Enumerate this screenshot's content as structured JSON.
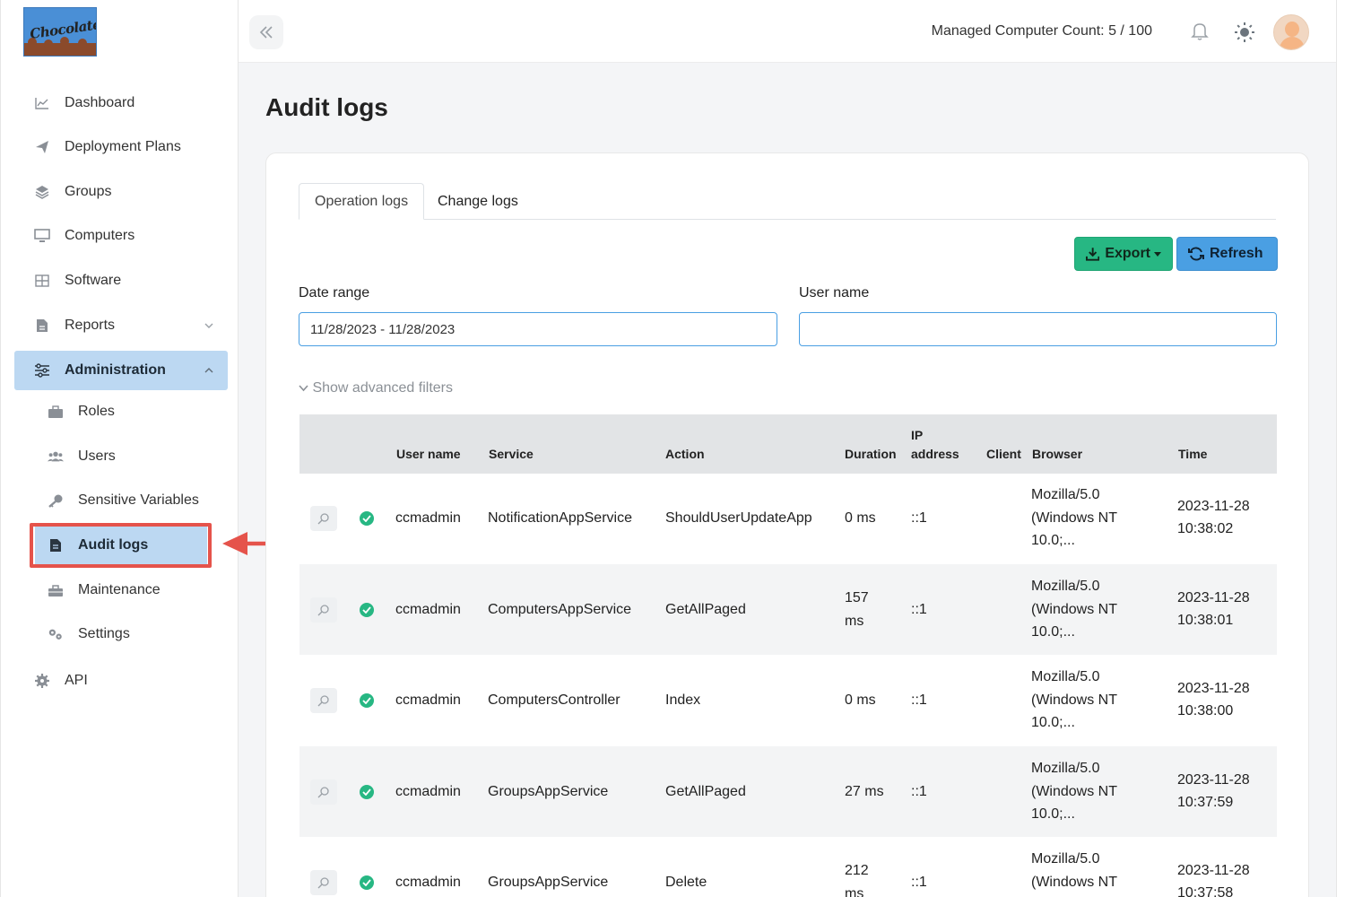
{
  "brand": {
    "logo_text": "Chocolatey"
  },
  "header": {
    "computer_count": "Managed Computer Count: 5 / 100"
  },
  "sidebar": {
    "items": [
      {
        "label": "Dashboard",
        "icon": "chart-line-icon"
      },
      {
        "label": "Deployment Plans",
        "icon": "paper-plane-icon"
      },
      {
        "label": "Groups",
        "icon": "layers-icon"
      },
      {
        "label": "Computers",
        "icon": "monitor-icon"
      },
      {
        "label": "Software",
        "icon": "grid-icon"
      },
      {
        "label": "Reports",
        "icon": "report-icon"
      },
      {
        "label": "Administration",
        "icon": "sliders-icon"
      },
      {
        "label": "API",
        "icon": "gear-icon"
      }
    ],
    "admin_sub": [
      {
        "label": "Roles",
        "icon": "briefcase-icon"
      },
      {
        "label": "Users",
        "icon": "users-icon"
      },
      {
        "label": "Sensitive Variables",
        "icon": "key-icon"
      },
      {
        "label": "Audit logs",
        "icon": "document-icon"
      },
      {
        "label": "Maintenance",
        "icon": "toolbox-icon"
      },
      {
        "label": "Settings",
        "icon": "gears-icon"
      }
    ]
  },
  "page": {
    "title": "Audit logs"
  },
  "tabs": [
    "Operation logs",
    "Change logs"
  ],
  "actions": {
    "export": "Export",
    "refresh": "Refresh"
  },
  "filters": {
    "date_label": "Date range",
    "date_value": "11/28/2023 - 11/28/2023",
    "user_label": "User name",
    "user_value": "",
    "advanced": "Show advanced filters"
  },
  "table": {
    "headers": {
      "user": "User name",
      "service": "Service",
      "action": "Action",
      "duration": "Duration",
      "ip_1": "IP",
      "ip_2": "address",
      "client": "Client",
      "browser": "Browser",
      "time": "Time"
    },
    "rows": [
      {
        "user": "ccmadmin",
        "service": "NotificationAppService",
        "action": "ShouldUserUpdateApp",
        "duration_1": "0 ms",
        "duration_2": "",
        "ip": "::1",
        "client": "",
        "browser_1": "Mozilla/5.0",
        "browser_2": "(Windows NT",
        "browser_3": "10.0;...",
        "date": "2023-11-28",
        "time": "10:38:02"
      },
      {
        "user": "ccmadmin",
        "service": "ComputersAppService",
        "action": "GetAllPaged",
        "duration_1": "157",
        "duration_2": "ms",
        "ip": "::1",
        "client": "",
        "browser_1": "Mozilla/5.0",
        "browser_2": "(Windows NT",
        "browser_3": "10.0;...",
        "date": "2023-11-28",
        "time": "10:38:01"
      },
      {
        "user": "ccmadmin",
        "service": "ComputersController",
        "action": "Index",
        "duration_1": "0 ms",
        "duration_2": "",
        "ip": "::1",
        "client": "",
        "browser_1": "Mozilla/5.0",
        "browser_2": "(Windows NT",
        "browser_3": "10.0;...",
        "date": "2023-11-28",
        "time": "10:38:00"
      },
      {
        "user": "ccmadmin",
        "service": "GroupsAppService",
        "action": "GetAllPaged",
        "duration_1": "27 ms",
        "duration_2": "",
        "ip": "::1",
        "client": "",
        "browser_1": "Mozilla/5.0",
        "browser_2": "(Windows NT",
        "browser_3": "10.0;...",
        "date": "2023-11-28",
        "time": "10:37:59"
      },
      {
        "user": "ccmadmin",
        "service": "GroupsAppService",
        "action": "Delete",
        "duration_1": "212",
        "duration_2": "ms",
        "ip": "::1",
        "client": "",
        "browser_1": "Mozilla/5.0",
        "browser_2": "(Windows NT",
        "browser_3": "",
        "date": "2023-11-28",
        "time": "10:37:58"
      }
    ]
  },
  "colors": {
    "accent": "#4a9fe3",
    "success": "#27b783",
    "active_nav": "#bcd8f2",
    "highlight": "#e5534b"
  }
}
